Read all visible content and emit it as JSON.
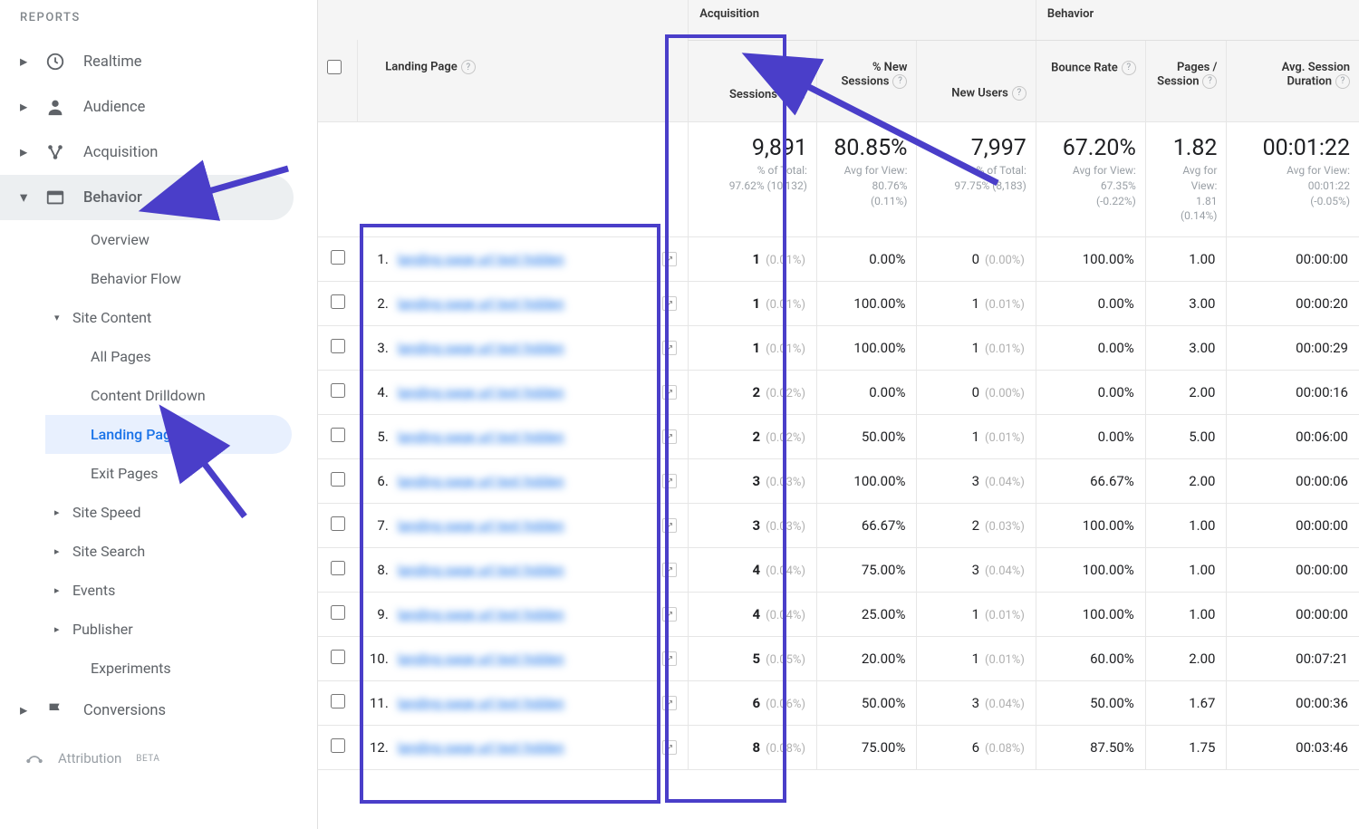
{
  "sidebar": {
    "heading": "REPORTS",
    "items": [
      {
        "label": "Realtime",
        "icon": "clock"
      },
      {
        "label": "Audience",
        "icon": "person"
      },
      {
        "label": "Acquisition",
        "icon": "nodes"
      },
      {
        "label": "Behavior",
        "icon": "window",
        "expanded": true
      },
      {
        "label": "Conversions",
        "icon": "flag"
      }
    ],
    "behavior_sub": [
      {
        "label": "Overview"
      },
      {
        "label": "Behavior Flow"
      },
      {
        "label": "Site Content",
        "expanded": true
      },
      {
        "label": "Site Speed",
        "has_chev": true
      },
      {
        "label": "Site Search",
        "has_chev": true
      },
      {
        "label": "Events",
        "has_chev": true
      },
      {
        "label": "Publisher",
        "has_chev": true
      },
      {
        "label": "Experiments"
      }
    ],
    "site_content_sub": [
      {
        "label": "All Pages"
      },
      {
        "label": "Content Drilldown"
      },
      {
        "label": "Landing Pages",
        "selected": true
      },
      {
        "label": "Exit Pages"
      }
    ],
    "attribution": {
      "label": "Attribution",
      "badge": "BETA"
    }
  },
  "table": {
    "groups": {
      "acquisition": "Acquisition",
      "behavior": "Behavior"
    },
    "columns": {
      "landing_page": "Landing Page",
      "sessions": "Sessions",
      "pct_new_sessions": "% New Sessions",
      "new_users": "New Users",
      "bounce_rate": "Bounce Rate",
      "pages_per_session": "Pages / Session",
      "avg_session_duration": "Avg. Session Duration"
    },
    "totals": {
      "sessions": {
        "value": "9,891",
        "sub1": "% of Total:",
        "sub2": "97.62% (10,132)"
      },
      "pct_new_sessions": {
        "value": "80.85%",
        "sub1": "Avg for View:",
        "sub2": "80.76%",
        "sub3": "(0.11%)"
      },
      "new_users": {
        "value": "7,997",
        "sub1": "% of Total:",
        "sub2": "97.75% (8,183)"
      },
      "bounce_rate": {
        "value": "67.20%",
        "sub1": "Avg for View:",
        "sub2": "67.35%",
        "sub3": "(-0.22%)"
      },
      "pages_per_session": {
        "value": "1.82",
        "sub1": "Avg for",
        "sub2": "View:",
        "sub3": "1.81",
        "sub4": "(0.14%)"
      },
      "avg_session_duration": {
        "value": "00:01:22",
        "sub1": "Avg for View:",
        "sub2": "00:01:22",
        "sub3": "(-0.05%)"
      }
    },
    "rows": [
      {
        "n": "1.",
        "sessions": "1",
        "sessions_pct": "(0.01%)",
        "pct_new": "0.00%",
        "new_users": "0",
        "new_users_pct": "(0.00%)",
        "bounce": "100.00%",
        "pps": "1.00",
        "dur": "00:00:00"
      },
      {
        "n": "2.",
        "sessions": "1",
        "sessions_pct": "(0.01%)",
        "pct_new": "100.00%",
        "new_users": "1",
        "new_users_pct": "(0.01%)",
        "bounce": "0.00%",
        "pps": "3.00",
        "dur": "00:00:20"
      },
      {
        "n": "3.",
        "sessions": "1",
        "sessions_pct": "(0.01%)",
        "pct_new": "100.00%",
        "new_users": "1",
        "new_users_pct": "(0.01%)",
        "bounce": "0.00%",
        "pps": "3.00",
        "dur": "00:00:29"
      },
      {
        "n": "4.",
        "sessions": "2",
        "sessions_pct": "(0.02%)",
        "pct_new": "0.00%",
        "new_users": "0",
        "new_users_pct": "(0.00%)",
        "bounce": "0.00%",
        "pps": "2.00",
        "dur": "00:00:16"
      },
      {
        "n": "5.",
        "sessions": "2",
        "sessions_pct": "(0.02%)",
        "pct_new": "50.00%",
        "new_users": "1",
        "new_users_pct": "(0.01%)",
        "bounce": "0.00%",
        "pps": "5.00",
        "dur": "00:06:00"
      },
      {
        "n": "6.",
        "sessions": "3",
        "sessions_pct": "(0.03%)",
        "pct_new": "100.00%",
        "new_users": "3",
        "new_users_pct": "(0.04%)",
        "bounce": "66.67%",
        "pps": "2.00",
        "dur": "00:00:06"
      },
      {
        "n": "7.",
        "sessions": "3",
        "sessions_pct": "(0.03%)",
        "pct_new": "66.67%",
        "new_users": "2",
        "new_users_pct": "(0.03%)",
        "bounce": "100.00%",
        "pps": "1.00",
        "dur": "00:00:00"
      },
      {
        "n": "8.",
        "sessions": "4",
        "sessions_pct": "(0.04%)",
        "pct_new": "75.00%",
        "new_users": "3",
        "new_users_pct": "(0.04%)",
        "bounce": "100.00%",
        "pps": "1.00",
        "dur": "00:00:00"
      },
      {
        "n": "9.",
        "sessions": "4",
        "sessions_pct": "(0.04%)",
        "pct_new": "25.00%",
        "new_users": "1",
        "new_users_pct": "(0.01%)",
        "bounce": "100.00%",
        "pps": "1.00",
        "dur": "00:00:00"
      },
      {
        "n": "10.",
        "sessions": "5",
        "sessions_pct": "(0.05%)",
        "pct_new": "20.00%",
        "new_users": "1",
        "new_users_pct": "(0.01%)",
        "bounce": "60.00%",
        "pps": "2.00",
        "dur": "00:07:21"
      },
      {
        "n": "11.",
        "sessions": "6",
        "sessions_pct": "(0.06%)",
        "pct_new": "50.00%",
        "new_users": "3",
        "new_users_pct": "(0.04%)",
        "bounce": "50.00%",
        "pps": "1.67",
        "dur": "00:00:36"
      },
      {
        "n": "12.",
        "sessions": "8",
        "sessions_pct": "(0.08%)",
        "pct_new": "75.00%",
        "new_users": "6",
        "new_users_pct": "(0.08%)",
        "bounce": "87.50%",
        "pps": "1.75",
        "dur": "00:03:46"
      }
    ]
  }
}
